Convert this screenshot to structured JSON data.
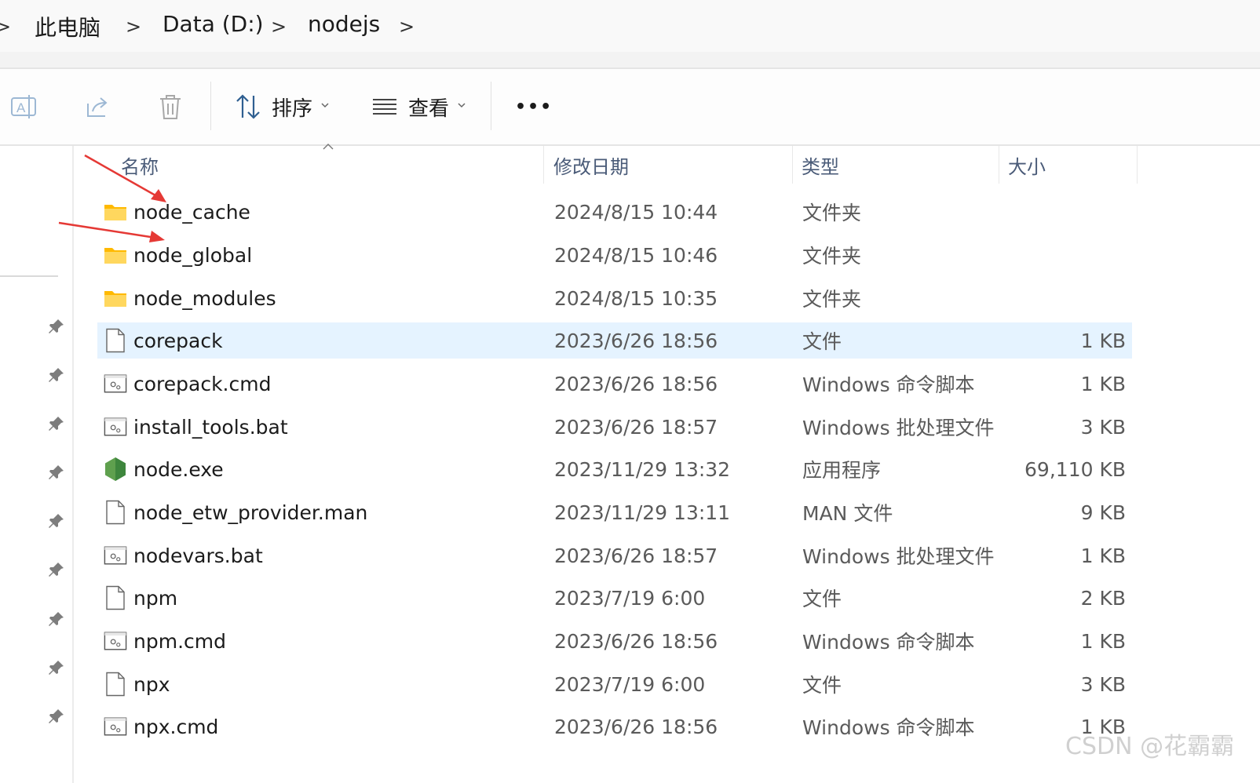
{
  "breadcrumb": {
    "items": [
      "此电脑",
      "Data (D:)",
      "nodejs"
    ],
    "separator": ">"
  },
  "toolbar": {
    "sort_label": "排序",
    "view_label": "查看",
    "more_label": "•••",
    "icons": [
      "rename-icon",
      "share-icon",
      "delete-icon"
    ]
  },
  "columns": {
    "name": "名称",
    "date": "修改日期",
    "type": "类型",
    "size": "大小"
  },
  "files": [
    {
      "name": "node_cache",
      "date": "2024/8/15 10:44",
      "type": "文件夹",
      "size": "",
      "icon": "folder-icon",
      "selected": false
    },
    {
      "name": "node_global",
      "date": "2024/8/15 10:46",
      "type": "文件夹",
      "size": "",
      "icon": "folder-icon",
      "selected": false
    },
    {
      "name": "node_modules",
      "date": "2024/8/15 10:35",
      "type": "文件夹",
      "size": "",
      "icon": "folder-icon",
      "selected": false
    },
    {
      "name": "corepack",
      "date": "2023/6/26 18:56",
      "type": "文件",
      "size": "1 KB",
      "icon": "file-icon",
      "selected": true
    },
    {
      "name": "corepack.cmd",
      "date": "2023/6/26 18:56",
      "type": "Windows 命令脚本",
      "size": "1 KB",
      "icon": "script-icon",
      "selected": false
    },
    {
      "name": "install_tools.bat",
      "date": "2023/6/26 18:57",
      "type": "Windows 批处理文件",
      "size": "3 KB",
      "icon": "script-icon",
      "selected": false
    },
    {
      "name": "node.exe",
      "date": "2023/11/29 13:32",
      "type": "应用程序",
      "size": "69,110 KB",
      "icon": "node-exe-icon",
      "selected": false
    },
    {
      "name": "node_etw_provider.man",
      "date": "2023/11/29 13:11",
      "type": "MAN 文件",
      "size": "9 KB",
      "icon": "file-icon",
      "selected": false
    },
    {
      "name": "nodevars.bat",
      "date": "2023/6/26 18:57",
      "type": "Windows 批处理文件",
      "size": "1 KB",
      "icon": "script-icon",
      "selected": false
    },
    {
      "name": "npm",
      "date": "2023/7/19 6:00",
      "type": "文件",
      "size": "2 KB",
      "icon": "file-icon",
      "selected": false
    },
    {
      "name": "npm.cmd",
      "date": "2023/6/26 18:56",
      "type": "Windows 命令脚本",
      "size": "1 KB",
      "icon": "script-icon",
      "selected": false
    },
    {
      "name": "npx",
      "date": "2023/7/19 6:00",
      "type": "文件",
      "size": "3 KB",
      "icon": "file-icon",
      "selected": false
    },
    {
      "name": "npx.cmd",
      "date": "2023/6/26 18:56",
      "type": "Windows 命令脚本",
      "size": "1 KB",
      "icon": "script-icon",
      "selected": false
    }
  ],
  "sidebar": {
    "pin_icon": "pin-icon",
    "pin_count": 9
  },
  "colors": {
    "selection": "#e5f3ff",
    "folder": "#ffc83d",
    "annotation_arrow": "#e53935",
    "header_text": "#4a5b78"
  },
  "watermark": "CSDN @花霸霸"
}
